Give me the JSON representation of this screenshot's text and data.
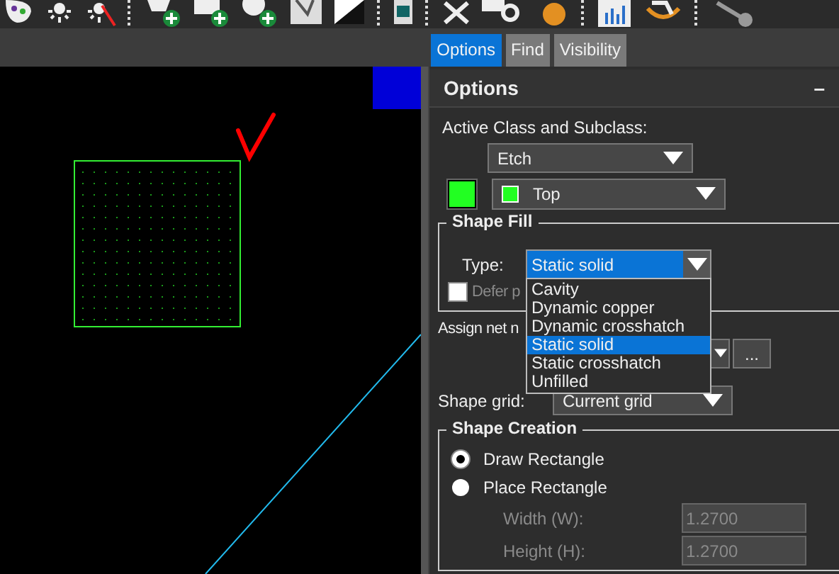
{
  "tabs": [
    {
      "label": "Options",
      "selected": true
    },
    {
      "label": "Find",
      "selected": false
    },
    {
      "label": "Visibility",
      "selected": false
    }
  ],
  "panel": {
    "title": "Options",
    "minimize": "–",
    "active_class_label": "Active Class and Subclass:",
    "class_select": "Etch",
    "subclass_select": "Top",
    "shape_fill": {
      "title": "Shape Fill",
      "type_label": "Type:",
      "type_value": "Static solid",
      "defer_checkbox": {
        "label": "Defer p",
        "checked": false
      },
      "type_options": [
        {
          "label": "Cavity",
          "selected": false
        },
        {
          "label": "Dynamic copper",
          "selected": false
        },
        {
          "label": "Dynamic crosshatch",
          "selected": false
        },
        {
          "label": "Static solid",
          "selected": true
        },
        {
          "label": "Static crosshatch",
          "selected": false
        },
        {
          "label": "Unfilled",
          "selected": false
        }
      ]
    },
    "assign_net_label": "Assign net n",
    "browse_button": "...",
    "shape_grid_label": "Shape grid:",
    "shape_grid_value": "Current grid",
    "shape_creation": {
      "title": "Shape Creation",
      "options": [
        {
          "label": "Draw Rectangle",
          "selected": true
        },
        {
          "label": "Place Rectangle",
          "selected": false
        }
      ],
      "fields": [
        {
          "label": "Width (W):",
          "value": "1.2700",
          "disabled": true
        },
        {
          "label": "Height (H):",
          "value": "1.2700",
          "disabled": true
        }
      ]
    }
  }
}
